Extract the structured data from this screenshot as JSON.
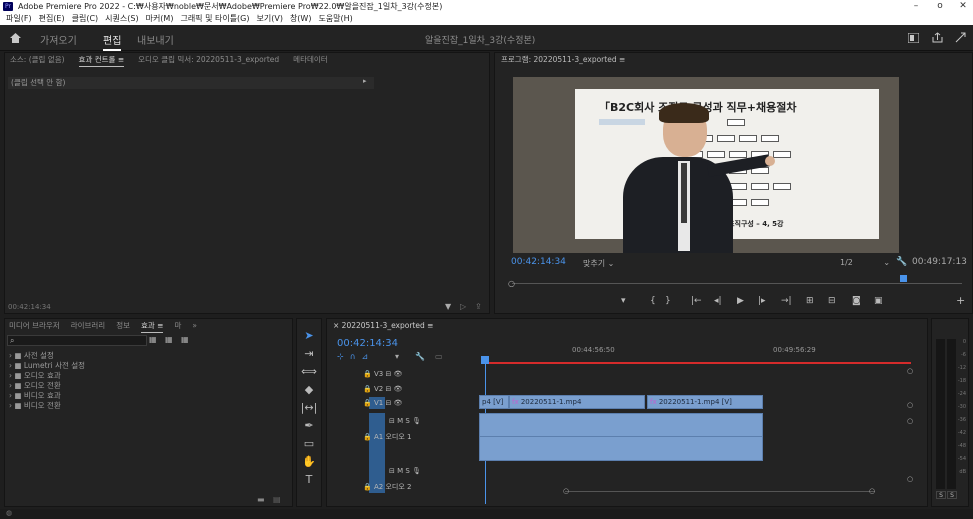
{
  "window": {
    "title": "Adobe Premiere Pro 2022 - C:₩사용자₩noble₩문서₩Adobe₩Premiere Pro₩22.0₩알을진잡_1일차_3강(수정본)",
    "app_badge": "Pr",
    "minimize": "–",
    "restore": "o",
    "close": "✕"
  },
  "menu": [
    "파일(F)",
    "편집(E)",
    "클립(C)",
    "시퀀스(S)",
    "마커(M)",
    "그래픽 및 타이틀(G)",
    "보기(V)",
    "창(W)",
    "도움말(H)"
  ],
  "nav": {
    "home_icon": "home-icon",
    "tabs": [
      "가져오기",
      "편집",
      "내보내기"
    ],
    "active": "편집",
    "project": "알을진잡_1일차_3강(수정본)"
  },
  "source_panel": {
    "tabs": [
      "소스: (클립 없음)",
      "효과 컨트롤 ≡",
      "오디오 클립 믹서: 20220511-3_exported",
      "메타데이터"
    ],
    "no_clip": "(클립 선택 안 함)",
    "timecode": "00:42:14:34"
  },
  "program": {
    "title": "프로그램: 20220511-3_exported ≡",
    "slide_title": "「B2C회사 조직도 구성과 직무+채용절차",
    "slide_caption": "로 할 기타 조직구성 – 4, 5강",
    "timecode": "00:42:14:34",
    "fit": "맞추기",
    "quality": "1/2",
    "duration": "00:49:17:13"
  },
  "effects_panel": {
    "tabs": [
      "미디어 브라우저",
      "라이브러리",
      "정보",
      "효과 ≡",
      "마",
      "»"
    ],
    "items": [
      "사전 설정",
      "Lumetri 사전 설정",
      "오디오 효과",
      "오디오 전환",
      "비디오 효과",
      "비디오 전환"
    ]
  },
  "timeline": {
    "sequence": "20220511-3_exported ≡",
    "timecode": "00:42:14:34",
    "ruler": [
      "00:44:56:50",
      "00:49:56:29"
    ],
    "tracks": [
      {
        "name": "V3"
      },
      {
        "name": "V2"
      },
      {
        "name": "V1"
      },
      {
        "name": "A1",
        "label": "오디오 1"
      },
      {
        "name": "A2",
        "label": "오디오 2"
      }
    ],
    "clips": [
      "p4 [V]",
      "20220511-1.mp4",
      "20220511-1.mp4 [V]"
    ],
    "track_tools": [
      "M",
      "S"
    ]
  },
  "meter": {
    "labels": [
      "0",
      "-6",
      "-12",
      "-18",
      "-24",
      "-30",
      "-36",
      "-42",
      "-48",
      "-54",
      "dB"
    ],
    "solo": [
      "S",
      "S"
    ]
  }
}
